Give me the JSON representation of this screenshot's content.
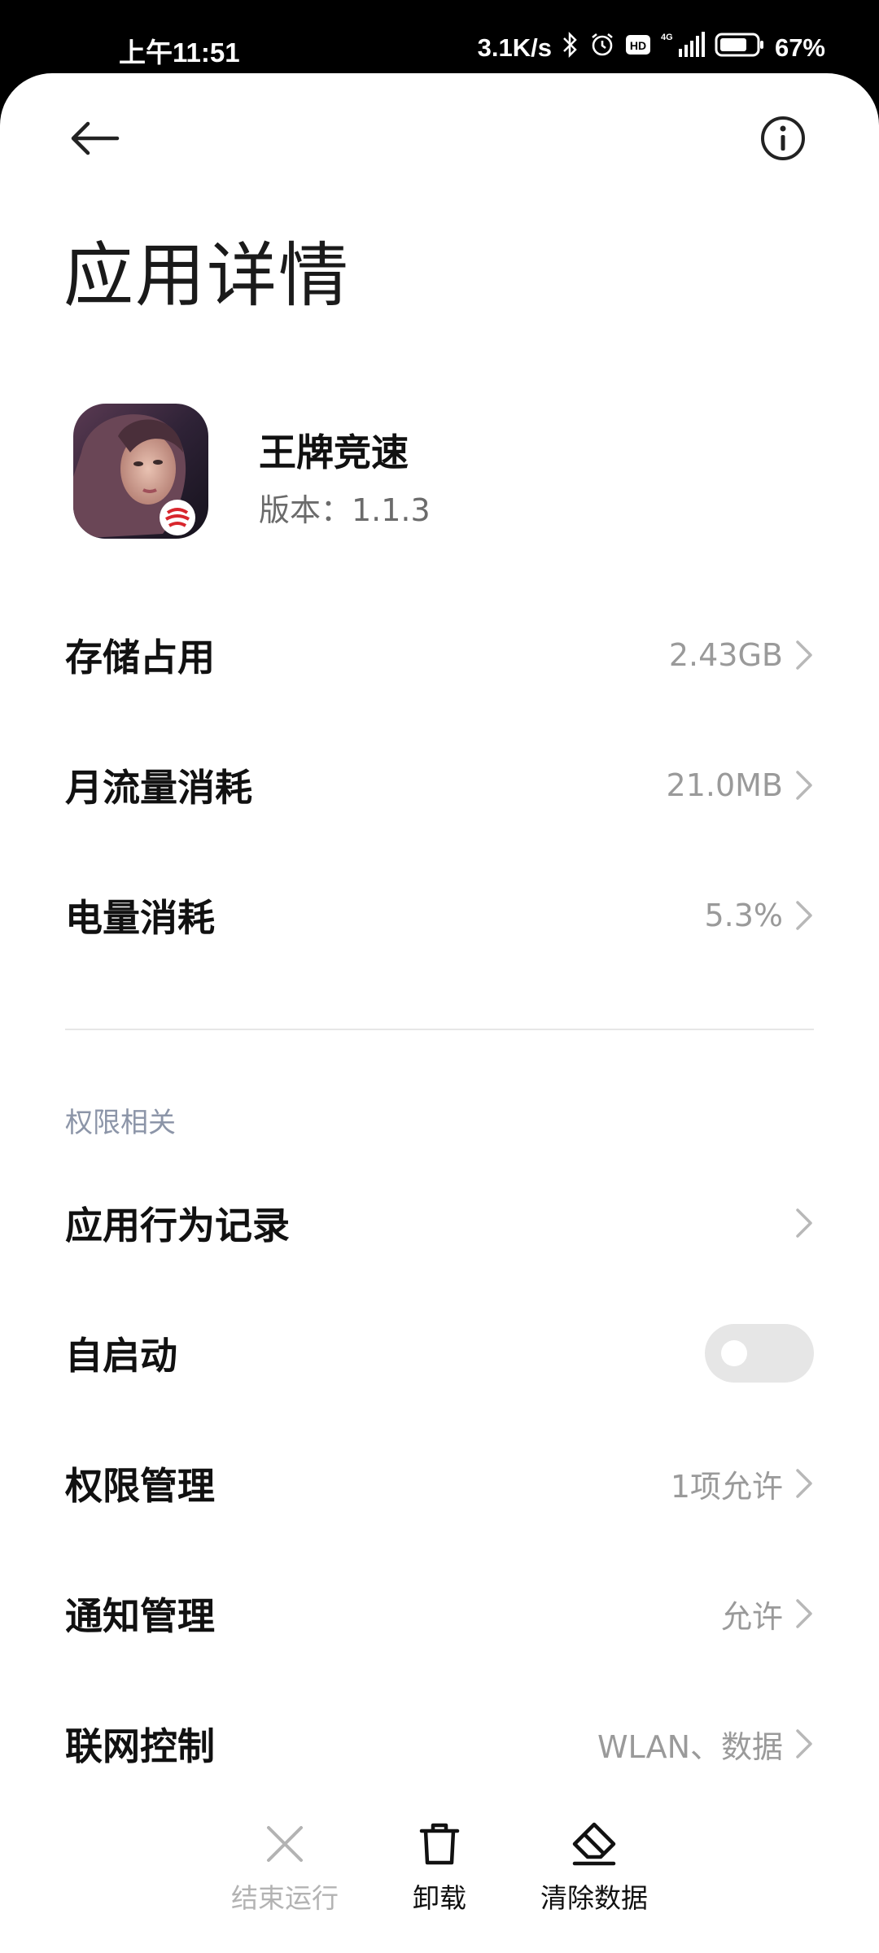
{
  "status_bar": {
    "time": "上午11:51",
    "speed": "3.1K/s",
    "network": "4G",
    "battery": "67%"
  },
  "header": {
    "title": "应用详情"
  },
  "app": {
    "name": "王牌竞速",
    "version": "版本：1.1.3"
  },
  "usage": [
    {
      "label": "存储占用",
      "value": "2.43GB"
    },
    {
      "label": "月流量消耗",
      "value": "21.0MB"
    },
    {
      "label": "电量消耗",
      "value": "5.3%"
    }
  ],
  "permissions": {
    "section_title": "权限相关",
    "items": [
      {
        "label": "应用行为记录",
        "value": ""
      },
      {
        "label": "自启动",
        "toggle": false
      },
      {
        "label": "权限管理",
        "value": "1项允许"
      },
      {
        "label": "通知管理",
        "value": "允许"
      },
      {
        "label": "联网控制",
        "value": "WLAN、数据"
      }
    ]
  },
  "bottom_actions": [
    {
      "label": "结束运行",
      "enabled": false,
      "icon": "close-icon"
    },
    {
      "label": "卸载",
      "enabled": true,
      "icon": "trash-icon"
    },
    {
      "label": "清除数据",
      "enabled": true,
      "icon": "eraser-icon"
    }
  ],
  "colors": {
    "text_primary": "#111111",
    "text_secondary": "#9a9a9a",
    "section_header": "#8c95a8",
    "toggle_off": "#e6e6e6"
  }
}
